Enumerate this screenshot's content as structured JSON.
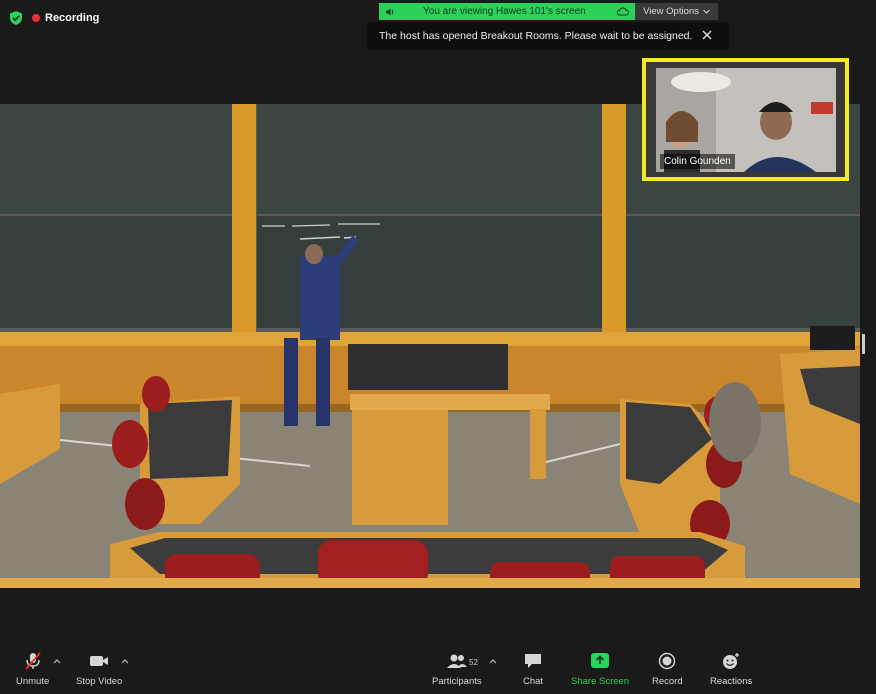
{
  "status": {
    "recording_label": "Recording"
  },
  "share_banner": {
    "viewing_text": "You are viewing Hawes 101's screen",
    "view_options_label": "View Options"
  },
  "notification": {
    "text": "The host has opened Breakout Rooms. Please wait to be assigned."
  },
  "participant_tile": {
    "name": "Colin Gounden"
  },
  "toolbar": {
    "unmute_label": "Unmute",
    "stop_video_label": "Stop Video",
    "participants_label": "Participants",
    "participants_count": "52",
    "chat_label": "Chat",
    "share_screen_label": "Share Screen",
    "record_label": "Record",
    "reactions_label": "Reactions"
  },
  "colors": {
    "share_green": "#2bd25a",
    "tile_border": "#f3ec1c",
    "recording_red": "#e8322f"
  }
}
